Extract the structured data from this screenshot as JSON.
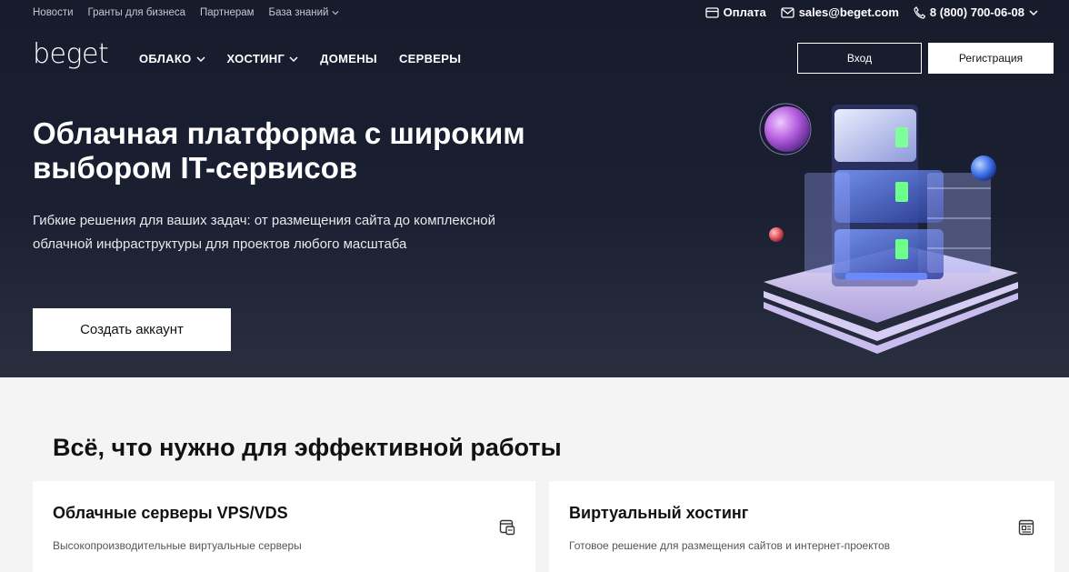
{
  "topbar": {
    "links": [
      "Новости",
      "Гранты для бизнеса",
      "Партнерам",
      "База знаний"
    ],
    "payment": "Оплата",
    "email": "sales@beget.com",
    "phone": "8 (800) 700-06-08"
  },
  "nav": {
    "logo": "beget",
    "items": [
      "ОБЛАКО",
      "ХОСТИНГ",
      "ДОМЕНЫ",
      "СЕРВЕРЫ"
    ],
    "login": "Вход",
    "register": "Регистрация"
  },
  "hero": {
    "title_line1": "Облачная платформа с широким",
    "title_line2": "выбором IT-сервисов",
    "subtitle_line1": "Гибкие решения для ваших задач: от размещения сайта до комплексной",
    "subtitle_line2": "облачной инфраструктуры для проектов любого масштаба",
    "cta": "Создать аккаунт"
  },
  "features": {
    "title": "Всё, что нужно для эффективной работы",
    "cards": [
      {
        "title": "Облачные серверы VPS/VDS",
        "desc": "Высокопроизводительные виртуальные серверы",
        "icon": "server-window-icon"
      },
      {
        "title": "Виртуальный хостинг",
        "desc": "Готовое решение для размещения сайтов и интернет-проектов",
        "icon": "browser-icon"
      }
    ]
  }
}
